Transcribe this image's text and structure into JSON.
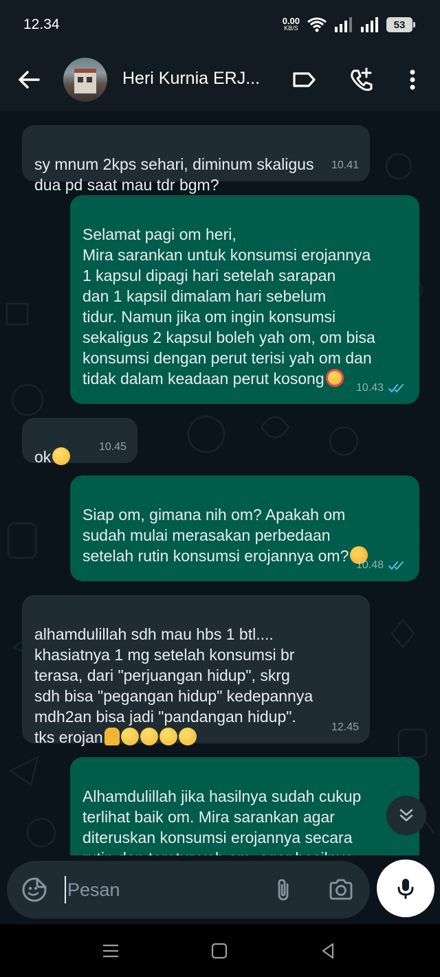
{
  "status_bar": {
    "time": "12.34",
    "net_speed_value": "0.00",
    "net_speed_unit": "KB/S",
    "battery": "53"
  },
  "header": {
    "contact_name": "Heri Kurnia ERJ..."
  },
  "messages": [
    {
      "direction": "incoming",
      "text": "sy mnum 2kps sehari, diminum skaligus\ndua pd saat mau tdr bgm?",
      "time": "10.41"
    },
    {
      "direction": "outgoing",
      "text": "Selamat pagi om heri,\nMira sarankan untuk konsumsi erojannya\n1 kapsul dipagi hari setelah sarapan\ndan 1 kapsil dimalam hari sebelum\ntidur. Namun jika om ingin konsumsi\nsekaligus 2 kapsul boleh yah om, om bisa\nkonsumsi dengan perut terisi yah om dan\ntidak dalam keadaan perut kosong",
      "time": "10.43",
      "emoji": "smiling-face-with-hearts"
    },
    {
      "direction": "incoming",
      "text": "ok",
      "time": "10.45",
      "emoji": "ok-hand"
    },
    {
      "direction": "outgoing",
      "text": "Siap om, gimana nih om? Apakah om\nsudah mulai merasakan perbedaan\nsetelah rutin konsumsi erojannya om?",
      "time": "10.48",
      "emoji": "hugging-face"
    },
    {
      "direction": "incoming",
      "text": "alhamdulillah sdh mau hbs 1 btl....\nkhasiatnya 1 mg setelah konsumsi br\nterasa, dari \"perjuangan hidup\", skrg\nsdh bisa \"pegangan hidup\" kedepannya\nmdh2an bisa jadi \"pandangan hidup\".\ntks erojan",
      "time": "12.45",
      "emoji": "pray, ok-hand, thumbs-up x3"
    },
    {
      "direction": "outgoing",
      "text": "Alhamdulillah jika hasilnya sudah cukup\nterlihat baik om. Mira sarankan agar\nditeruskan konsumsi erojannya secara\nrutin dan teratur yah om, agar hasilnya",
      "time": ""
    }
  ],
  "input": {
    "placeholder": "Pesan"
  },
  "icons": [
    "back-arrow-icon",
    "label-icon",
    "add-call-icon",
    "more-vert-icon",
    "emoji-sticker-icon",
    "attach-icon",
    "camera-icon",
    "mic-icon",
    "scroll-down-icon",
    "read-ticks-icon"
  ],
  "colors": {
    "background": "#0b141a",
    "header": "#111b21",
    "incoming_bubble": "#202c33",
    "outgoing_bubble": "#005c4b",
    "read_ticks": "#53bdeb"
  }
}
